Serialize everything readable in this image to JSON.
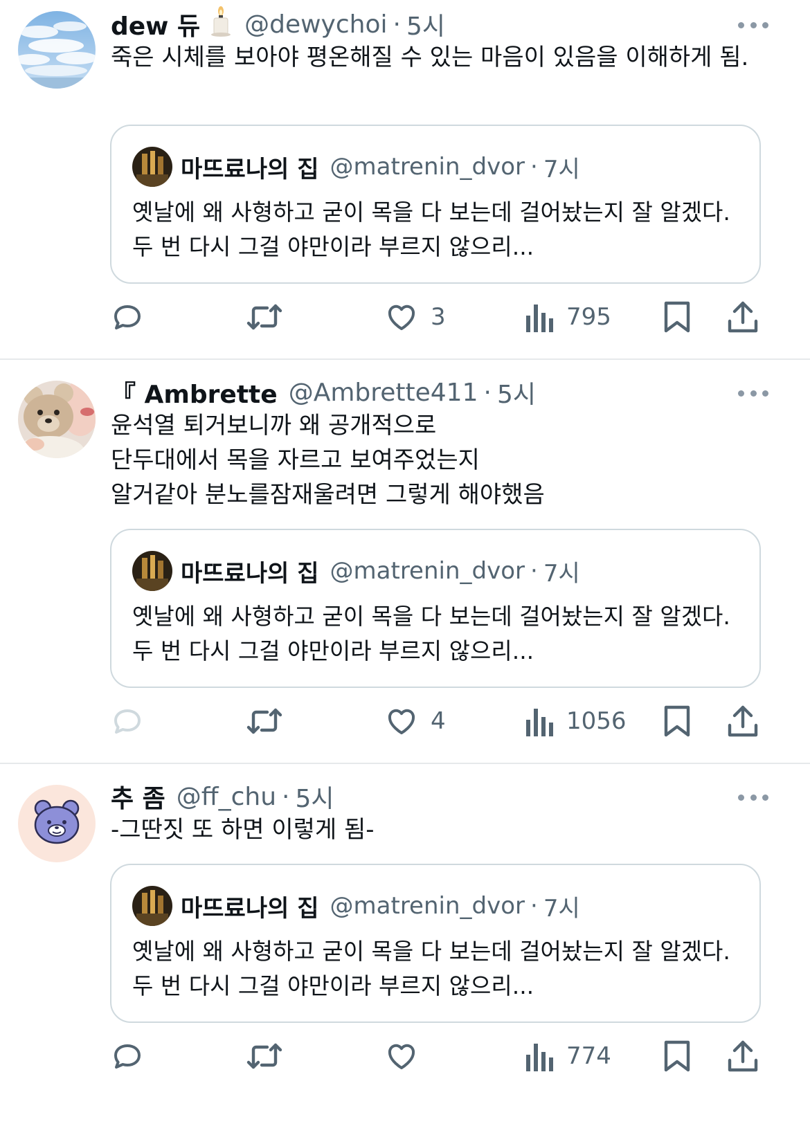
{
  "quoted_tweet": {
    "name": "마뜨료나의 집",
    "handle": "@matrenin_dvor",
    "time": "7시",
    "text": "옛날에 왜 사형하고 굳이 목을 다 보는데 걸어놨는지 잘 알겠다. 두 번 다시 그걸 야만이라 부르지 않으리..."
  },
  "tweets": [
    {
      "name": "dew 듀",
      "name_icon": "candle-icon",
      "handle": "@dewychoi",
      "dot": "·",
      "time": "5시",
      "text": "죽은 시체를 보아야 평온해질 수 있는 마음이 있음을 이해하게 됨.",
      "likes": "3",
      "views": "795"
    },
    {
      "name": "『 Ambrette",
      "handle": "@Ambrette411",
      "dot": "·",
      "time": "5시",
      "text": "윤석열 퇴거보니까 왜 공개적으로\n단두대에서 목을 자르고 보여주었는지\n알거같아 분노를잠재울려면 그렇게 해야했음",
      "likes": "4",
      "views": "1056"
    },
    {
      "name": "추 좀",
      "handle": "@ff_chu",
      "dot": "·",
      "time": "5시",
      "text": "-그딴짓 또 하면 이렇게 됨-",
      "likes": "",
      "views": "774"
    }
  ],
  "icons": {
    "reply": "reply-icon",
    "retweet": "retweet-icon",
    "like": "heart-icon",
    "views": "views-icon",
    "bookmark": "bookmark-icon",
    "share": "share-icon",
    "more": "more-icon"
  },
  "colors": {
    "text": "#0f1419",
    "secondary": "#536471",
    "border": "#cfd9de",
    "divider": "#e6e9eb",
    "icon": "#536471"
  }
}
